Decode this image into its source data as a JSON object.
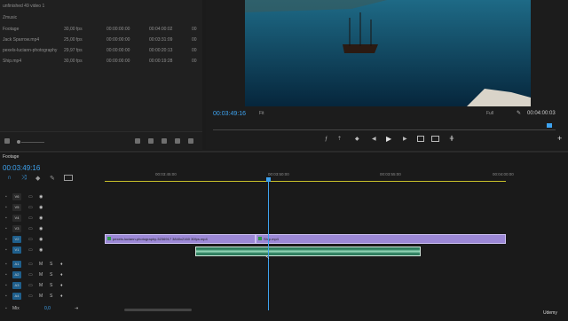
{
  "project": {
    "title": "unfinished 49 video 1",
    "bin": "Zmusic",
    "rows": [
      {
        "name": "Footage",
        "fps": "30,00 fps",
        "start": "00:00:00:00",
        "end": "00:04:00:02",
        "extra": "00"
      },
      {
        "name": "Jack Sparrow.mp4",
        "fps": "25,00 fps",
        "start": "00:00:00:00",
        "end": "00:03:31:09",
        "extra": "00"
      },
      {
        "name": "pexels-luciann-photography",
        "fps": "29,97 fps",
        "start": "00:00:00:00",
        "end": "00:00:20:13",
        "extra": "00"
      },
      {
        "name": "Ship.mp4",
        "fps": "30,00 fps",
        "start": "00:00:00:00",
        "end": "00:00:19:28",
        "extra": "00"
      }
    ]
  },
  "program": {
    "timecode": "00:03:49:16",
    "fit": "Fit",
    "quality": "Full",
    "duration": "00:04:00:03"
  },
  "timeline": {
    "tab": "Footage",
    "timecode": "00:03:49:16",
    "ruler": [
      "00:03:45:00",
      "00:03:50:00",
      "00:03:55:00",
      "00:04:00:00"
    ],
    "video_tracks": [
      "V6",
      "V5",
      "V4",
      "V3",
      "V2",
      "V1"
    ],
    "audio_tracks": [
      "A1",
      "A2",
      "A3",
      "A4"
    ],
    "mix_label": "Mix",
    "mix_value": "0,0",
    "clip_v1_a": "pexels-luciann-photography-5236917 3840x2160 30fps.mp4",
    "clip_v1_b": "Ship.mp4",
    "audio_label": "M",
    "solo_label": "S"
  },
  "watermark": "Udemy",
  "colors": {
    "accent": "#3ea3f0",
    "clip_video": "#9c88d6",
    "clip_audio": "#2f7d5e"
  }
}
